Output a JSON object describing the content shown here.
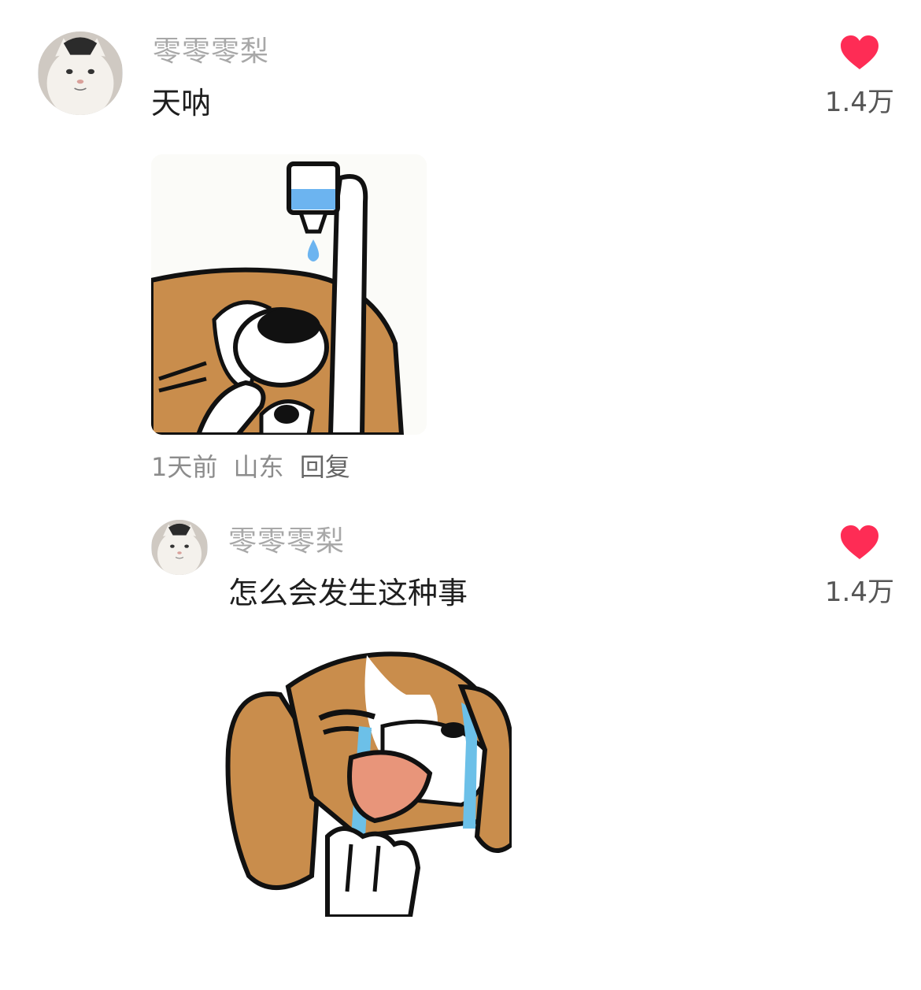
{
  "comments": [
    {
      "username": "零零零梨",
      "text": "天呐",
      "likes": "1.4万",
      "time": "1天前",
      "location": "山东",
      "reply_label": "回复",
      "avatar_icon": "white-cat-avatar",
      "sticker_icon": "dog-eye-drops-sticker"
    }
  ],
  "replies": [
    {
      "username": "零零零梨",
      "text": "怎么会发生这种事",
      "likes": "1.4万",
      "avatar_icon": "white-cat-avatar",
      "sticker_icon": "crying-dog-sticker"
    }
  ],
  "colors": {
    "like_heart": "#fe2c55",
    "username": "#a8a8a8",
    "dog_brown": "#c98d4c"
  }
}
